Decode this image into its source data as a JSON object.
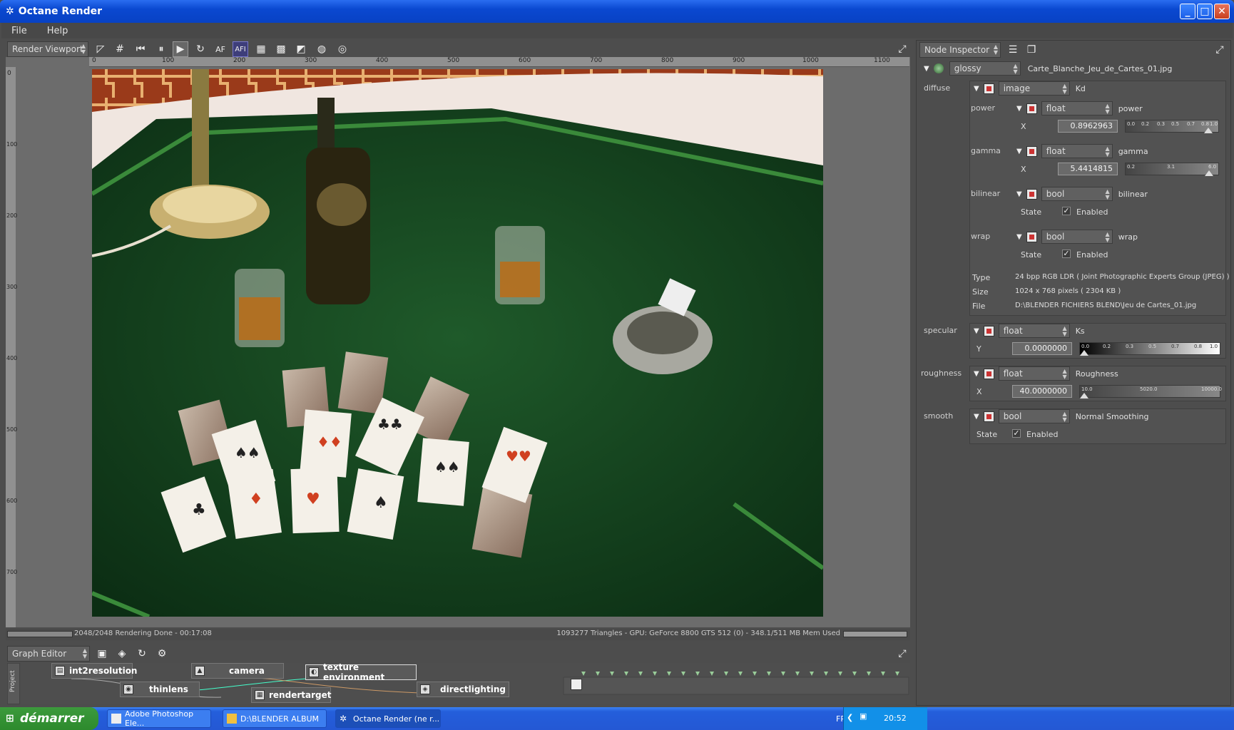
{
  "window": {
    "title": "Octane Render",
    "icon": "octane-logo-icon"
  },
  "menu": [
    "File",
    "Help"
  ],
  "viewport": {
    "mode": "Render Viewport",
    "tools": [
      "AF",
      "AFI"
    ],
    "ruler_h": [
      "0",
      "100",
      "200",
      "300",
      "400",
      "500",
      "600",
      "700",
      "800",
      "900",
      "1000",
      "1100"
    ],
    "ruler_v": [
      "0",
      "100",
      "200",
      "300",
      "400",
      "500",
      "600",
      "700"
    ],
    "status_left": "2048/2048 Rendering Done - 00:17:08",
    "status_right": "1093277 Triangles - GPU: GeForce 8800 GTS 512 (0) - 348.1/511 MB Mem Used"
  },
  "graph": {
    "title": "Graph Editor",
    "side_label": "Project",
    "nodes": [
      "int2resolution",
      "camera",
      "texture environment",
      "thinlens",
      "rendertarget",
      "directlighting"
    ]
  },
  "inspector": {
    "title": "Node Inspector",
    "root_type": "glossy",
    "root_name": "Carte_Blanche_Jeu_de_Cartes_01.jpg",
    "diffuse": {
      "label": "diffuse",
      "type": "image",
      "name": "Kd",
      "power": {
        "label": "power",
        "type": "float",
        "name": "power",
        "axis": "X",
        "value": "0.8962963",
        "scale": [
          "0.0",
          "0.2",
          "0.3",
          "0.5",
          "0.7",
          "0.8",
          "1.0"
        ],
        "level": 0.896
      },
      "gamma": {
        "label": "gamma",
        "type": "float",
        "name": "gamma",
        "axis": "X",
        "value": "5.4414815",
        "scale": [
          "0.2",
          "3.1",
          "6.0"
        ],
        "level": 0.903
      },
      "bilinear": {
        "label": "bilinear",
        "type": "bool",
        "name": "bilinear",
        "state_label": "State",
        "state": "Enabled"
      },
      "wrap": {
        "label": "wrap",
        "type": "bool",
        "name": "wrap",
        "state_label": "State",
        "state": "Enabled"
      },
      "info": {
        "type_label": "Type",
        "type": "24 bpp RGB LDR ( Joint Photographic Experts Group (JPEG) )",
        "size_label": "Size",
        "size": "1024 x 768 pixels ( 2304 KB )",
        "file_label": "File",
        "file": "D:\\BLENDER FICHIERS BLEND\\Jeu de Cartes_01.jpg"
      }
    },
    "specular": {
      "label": "specular",
      "type": "float",
      "name": "Ks",
      "axis": "Y",
      "value": "0.0000000",
      "scale": [
        "0.0",
        "0.2",
        "0.3",
        "0.5",
        "0.7",
        "0.8",
        "1.0"
      ],
      "level": 0.0
    },
    "roughness": {
      "label": "roughness",
      "type": "float",
      "name": "Roughness",
      "axis": "X",
      "value": "40.0000000",
      "scale": [
        "10.0",
        "5020.0",
        "10000.0"
      ],
      "level": 0.003
    },
    "smooth": {
      "label": "smooth",
      "type": "bool",
      "name": "Normal Smoothing",
      "state_label": "State",
      "state": "Enabled"
    }
  },
  "taskbar": {
    "start": "démarrer",
    "tasks": [
      "Adobe Photoshop Ele...",
      "D:\\BLENDER ALBUM",
      "Octane Render (ne r..."
    ],
    "lang": "FR",
    "clock": "20:52"
  }
}
